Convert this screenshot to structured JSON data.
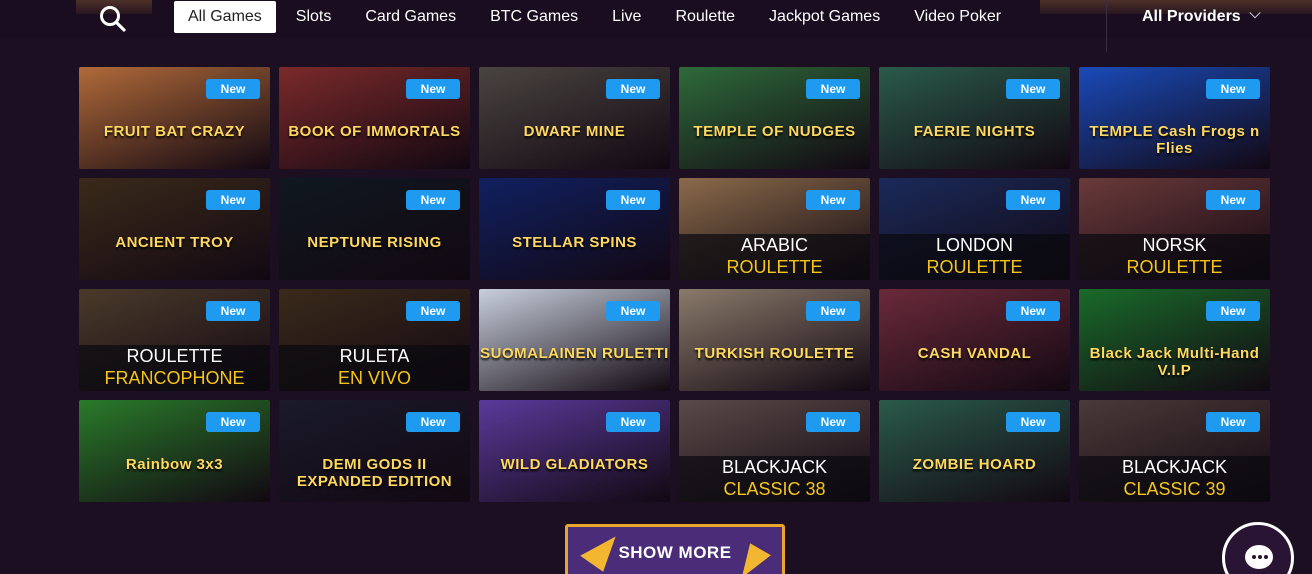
{
  "nav": {
    "tabs": [
      "All Games",
      "Slots",
      "Card Games",
      "BTC Games",
      "Live",
      "Roulette",
      "Jackpot Games",
      "Video Poker"
    ],
    "active_tab": "All Games",
    "providers_label": "All Providers"
  },
  "badge_label": "New",
  "games": [
    {
      "title": "FRUIT BAT CRAZY",
      "bg": "#b06a3a"
    },
    {
      "title": "BOOK OF IMMORTALS",
      "bg": "#7a2a2a"
    },
    {
      "title": "DWARF MINE",
      "bg": "#4a4440"
    },
    {
      "title": "TEMPLE OF NUDGES",
      "bg": "#2e6a3a"
    },
    {
      "title": "FAERIE NIGHTS",
      "bg": "#2a5a4a"
    },
    {
      "title": "TEMPLE Cash Frogs n Flies",
      "bg": "#1a4ab8"
    },
    {
      "title": "ANCIENT TROY",
      "bg": "#3a2a1a"
    },
    {
      "title": "NEPTUNE RISING",
      "bg": "#101820"
    },
    {
      "title": "STELLAR SPINS",
      "bg": "#102060"
    },
    {
      "line1": "ARABIC",
      "line2": "ROULETTE",
      "bg": "#8a6a4a"
    },
    {
      "line1": "LONDON",
      "line2": "ROULETTE",
      "bg": "#1a2a5a"
    },
    {
      "line1": "NORSK",
      "line2": "ROULETTE",
      "bg": "#6a3a3a"
    },
    {
      "line1": "ROULETTE",
      "line2": "FRANCOPHONE",
      "bg": "#4a3a2a"
    },
    {
      "line1": "RULETA",
      "line2": "EN VIVO",
      "bg": "#3a2a1a"
    },
    {
      "title": "SUOMALAINEN RULETTI",
      "bg": "#c8d0dc"
    },
    {
      "title": "TURKISH ROULETTE",
      "bg": "#8a7a6a"
    },
    {
      "title": "CASH VANDAL",
      "bg": "#6a2a3a"
    },
    {
      "title": "Black Jack Multi-Hand V.I.P",
      "bg": "#1a6a2a"
    },
    {
      "title": "Rainbow 3x3",
      "bg": "#2a7a2a"
    },
    {
      "title": "DEMI GODS II EXPANDED EDITION",
      "bg": "#1a1a2a"
    },
    {
      "title": "WILD GLADIATORS",
      "bg": "#5a3a9a"
    },
    {
      "line1": "BLACKJACK",
      "line2": "CLASSIC 38",
      "bg": "#5a4a48"
    },
    {
      "title": "ZOMBIE HOARD",
      "bg": "#2a5a4a"
    },
    {
      "line1": "BLACKJACK",
      "line2": "CLASSIC 39",
      "bg": "#4a3a38"
    }
  ],
  "show_more_label": "SHOW MORE",
  "colors": {
    "accent": "#1e9bf0",
    "gold": "#f5c518",
    "background": "#1c0f22"
  }
}
